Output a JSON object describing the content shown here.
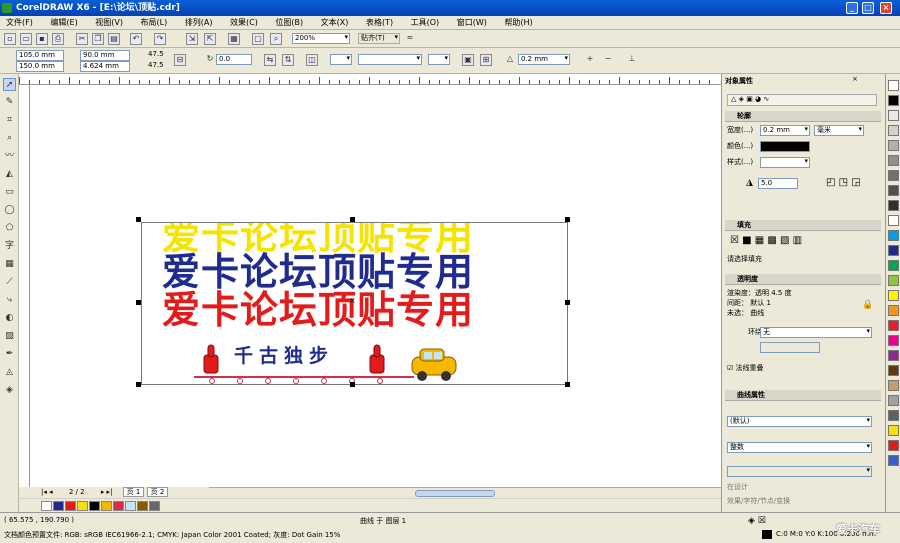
{
  "window": {
    "title": "CorelDRAW X6 - [E:\\论坛\\顶贴.cdr]"
  },
  "menu": [
    "文件(F)",
    "编辑(E)",
    "视图(V)",
    "布局(L)",
    "排列(A)",
    "效果(C)",
    "位图(B)",
    "文本(X)",
    "表格(T)",
    "工具(O)",
    "窗口(W)",
    "帮助(H)"
  ],
  "toolbar1": {
    "zoom": "200%",
    "snap": "贴齐(T)"
  },
  "toolbar2": {
    "x": "105.0 mm",
    "y": "150.0 mm",
    "w": "90.0 mm",
    "h": "4.624 mm",
    "scale_x": "47.5",
    "scale_y": "47.5",
    "angle": "0.0",
    "outline_width": "0.2 mm"
  },
  "artwork": {
    "line1": "爱卡论坛顶贴专用",
    "line2": "爱卡论坛顶贴专用",
    "line3": "爱卡论坛顶贴专用",
    "slogan": "千古独步",
    "colors": {
      "yellow": "#f5e400",
      "blue": "#1f2b8f",
      "red": "#e31b1b",
      "pink": "#d0304a",
      "car": "#f5b800"
    }
  },
  "pagebar": {
    "count": "2 / 2",
    "page1": "页 1",
    "page2": "页 2"
  },
  "docker": {
    "title": "对象属性",
    "outline_section": "轮廓",
    "width_label": "宽度(...)",
    "width_value": "0.2 mm",
    "unit": "毫米",
    "color_label": "颜色(...)",
    "style_label": "样式(...)",
    "miter_value": "5.0",
    "fill_section": "填充",
    "fill_note": "请选择填充",
    "overprint_section": "透明度",
    "info1": "渲染度：透明 4.5 度",
    "info2": "间距：  默认 1",
    "info3": "未选：  曲线",
    "wrap_label": "环绕",
    "wrap_value": "无",
    "check_label": "法线重叠",
    "curve_section": "曲线属性",
    "style_value": "(默认)",
    "type_value": "整数",
    "bottom_note1": "在设计",
    "bottom_note2": "效果/字符/节点/变换"
  },
  "status": {
    "coords": "( 65.575 , 190.790 )",
    "profile": "文档颜色预置文件: RGB: sRGB IEC61966-2.1; CMYK: Japan Color 2001 Coated; 灰度: Dot Gain 15%",
    "layer": "曲线 于 图层 1",
    "fill_info": "C:0 M:0 Y:0 K:100 0.200 mm",
    "watermark": "爱卡汽车"
  },
  "colors": {
    "accent": "#0a5fd6",
    "chrome": "#ece9d8"
  }
}
